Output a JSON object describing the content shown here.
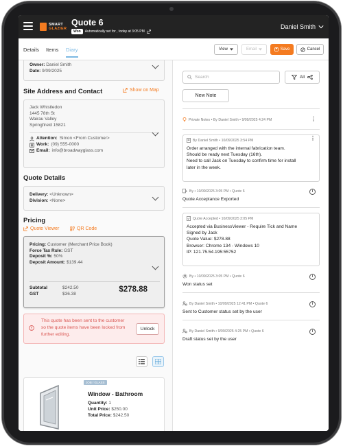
{
  "header": {
    "logo_top": "SMART",
    "logo_bottom": "GLAZIER",
    "title": "Quote 6",
    "status_badge": "Won",
    "status_subtitle": "Automatically set for , today at 3:05 PM",
    "user_name": "Daniel Smith"
  },
  "tabs": [
    {
      "label": "Details"
    },
    {
      "label": "Items"
    },
    {
      "label": "Diary",
      "active": true
    }
  ],
  "toolbar": {
    "view_label": "View",
    "email_label": "Email",
    "save_label": "Save",
    "cancel_label": "Cancel"
  },
  "owner_card": {
    "owner_label": "Owner:",
    "owner_value": "Daniel Smith",
    "date_label": "Date:",
    "date_value": "9/09/2025"
  },
  "site_address": {
    "title": "Site Address and Contact",
    "map_link": "Show on Map",
    "lines": [
      "Jack Whistledon",
      "1445 78th St",
      "Wairau Valley",
      "Springfireld 15821"
    ],
    "attention_label": "Attention:",
    "attention_value": "Simon <From Customer>",
    "work_label": "Work:",
    "work_value": "(09) 555-0000",
    "email_label": "Email:",
    "email_value": "info@broadwayglass.com"
  },
  "quote_details": {
    "title": "Quote Details",
    "delivery_label": "Delivery:",
    "delivery_value": "<Unknown>",
    "division_label": "Division:",
    "division_value": "<None>"
  },
  "pricing": {
    "title": "Pricing",
    "quote_viewer_link": "Quote Viewer",
    "qr_code_link": "QR Code",
    "pricing_label": "Pricing:",
    "pricing_value": "Customer (Merchant Price Book)",
    "force_tax_label": "Force Tax Rule:",
    "force_tax_value": "GST",
    "deposit_pct_label": "Deposit %:",
    "deposit_pct_value": "50%",
    "deposit_amt_label": "Deposit Amount:",
    "deposit_amt_value": "$139.44",
    "subtotal_label": "Subtotal",
    "subtotal_value": "$242.50",
    "gst_label": "GST",
    "gst_value": "$36.38",
    "total_value": "$278.88"
  },
  "lock_notice": {
    "message": "This quote has been sent to the customer so the quote items have been locked from further editing.",
    "unlock_label": "Unlock"
  },
  "product": {
    "tag": "JOB / GLASS",
    "name": "Window - Bathroom",
    "quantity_label": "Quantity:",
    "quantity_value": "1",
    "unit_price_label": "Unit Price:",
    "unit_price_value": "$250.00",
    "total_price_label": "Total Price:",
    "total_price_value": "$242.50"
  },
  "diary": {
    "search_placeholder": "Search",
    "filter_label": "All",
    "new_note_label": "New Note",
    "entries": [
      {
        "meta": "Private Notes • By Daniel Smith • 9/09/2025 4:24 PM",
        "text": ""
      },
      {
        "meta": "By Daniel Smith • 10/09/2025 3:54 PM",
        "text": [
          "Order arranged with the internal fabrication team.",
          "Should be ready next Tuesday (16th).",
          "Need to call Jack on Tuesday to confirm time for install",
          "later in the week."
        ]
      },
      {
        "meta": "By • 10/09/2025 3:05 PM • Quote 6",
        "text": "Quote Acceptance Exported"
      },
      {
        "meta": "Quote Accepted • 10/09/2025 3:05 PM",
        "text": [
          "Accepted via BusinessViewer - Require Tick and Name",
          "Signed by Jack",
          "Quote Value: $278.88",
          "Browser: Chrome 134 - Windows 10",
          "IP: 121.75.54.195:55752"
        ]
      },
      {
        "meta": "By • 10/09/2025 3:05 PM • Quote 6",
        "text": "Won status set"
      },
      {
        "meta": "By Daniel Smith • 10/09/2025 12:41 PM • Quote 6",
        "text": "Sent to Customer status set by the user"
      },
      {
        "meta": "By Daniel Smith • 9/09/2025 4:25 PM • Quote 6",
        "text": "Draft status set by the user"
      }
    ]
  },
  "colors": {
    "accent": "#f47b20",
    "tab_active": "#7ab8e3",
    "header_bg": "#232323",
    "lock_bg": "#fdecec",
    "lock_text": "#d9534f"
  }
}
